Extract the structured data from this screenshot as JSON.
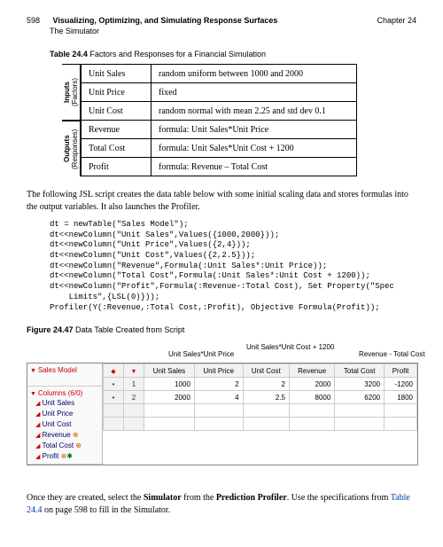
{
  "header": {
    "page_num": "598",
    "title": "Visualizing, Optimizing, and Simulating Response Surfaces",
    "subtitle": "The Simulator",
    "chapter": "Chapter 24"
  },
  "table_caption_prefix": "Table 24.4",
  "table_caption_rest": " Factors and Responses for a Financial Simulation",
  "vlabel1_a": "Inputs",
  "vlabel1_b": "(Factors)",
  "vlabel2_a": "Outputs",
  "vlabel2_b": "(Responses)",
  "factors": {
    "r0c0": "Unit Sales",
    "r0c1": "random uniform between 1000 and 2000",
    "r1c0": "Unit Price",
    "r1c1": "fixed",
    "r2c0": "Unit Cost",
    "r2c1": "random normal with mean 2.25 and std dev 0.1",
    "r3c0": "Revenue",
    "r3c1": "formula: Unit Sales*Unit Price",
    "r4c0": "Total Cost",
    "r4c1": "formula: Unit Sales*Unit Cost + 1200",
    "r5c0": "Profit",
    "r5c1": "formula: Revenue – Total Cost"
  },
  "para1": "The following JSL script creates the data table below with some initial scaling data and stores formulas into the output variables. It also launches the Profiler.",
  "code": "dt = newTable(\"Sales Model\");\ndt<<newColumn(\"Unit Sales\",Values({1000,2000}));\ndt<<newColumn(\"Unit Price\",Values({2,4}));\ndt<<newColumn(\"Unit Cost\",Values({2,2.5}));\ndt<<newColumn(\"Revenue\",Formula(:Unit Sales*:Unit Price));\ndt<<newColumn(\"Total Cost\",Formula(:Unit Sales*:Unit Cost + 1200));\ndt<<newColumn(\"Profit\",Formula(:Revenue-:Total Cost), Set Property(\"Spec\n    Limits\",{LSL(0)}));\nProfiler(Y(:Revenue,:Total Cost,:Profit), Objective Formula(Profit));",
  "fig_caption_prefix": "Figure 24.47",
  "fig_caption_rest": " Data Table Created from Script",
  "callout1": "Unit Sales*Unit Price",
  "callout2": "Unit Sales*Unit Cost + 1200",
  "callout3": "Revenue - Total Cost",
  "datatable": {
    "model_name": "Sales Model",
    "cols_header": "Columns (6/0)",
    "columns": [
      "Unit Sales",
      "Unit Price",
      "Unit Cost",
      "Revenue",
      "Total Cost",
      "Profit"
    ],
    "head": [
      "Unit Sales",
      "Unit Price",
      "Unit Cost",
      "Revenue",
      "Total Cost",
      "Profit"
    ],
    "rows": [
      {
        "n": "1",
        "c": [
          "1000",
          "2",
          "2",
          "2000",
          "3200",
          "-1200"
        ]
      },
      {
        "n": "2",
        "c": [
          "2000",
          "4",
          "2.5",
          "8000",
          "6200",
          "1800"
        ]
      }
    ]
  },
  "para2_a": "Once they are created, select the ",
  "para2_b": "Simulator",
  "para2_c": " from the ",
  "para2_d": "Prediction Profiler",
  "para2_e": ". Use the specifications from ",
  "para2_link": "Table 24.4",
  "para2_f": " on page 598 to fill in the Simulator."
}
